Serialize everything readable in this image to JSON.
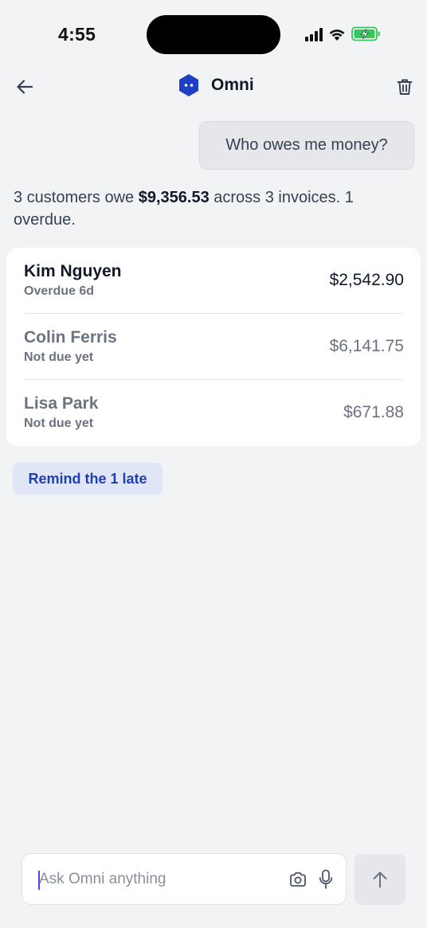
{
  "status_bar": {
    "time": "4:55",
    "icons": [
      "signal-icon",
      "wifi-icon",
      "battery-charging-icon"
    ],
    "battery_color": "#34c759"
  },
  "header": {
    "title": "Omni",
    "back_icon": "arrow-left-icon",
    "logo_icon": "hexagon-logo-icon",
    "delete_icon": "trash-icon",
    "brand_color": "#1f3fc4"
  },
  "conversation": {
    "user_message": "Who owes me money?",
    "summary": {
      "prefix": "3 customers owe ",
      "amount": "$9,356.53",
      "suffix": " across 3 invoices. 1 overdue."
    },
    "customers": [
      {
        "name": "Kim Nguyen",
        "status": "Overdue 6d",
        "amount": "$2,542.90"
      },
      {
        "name": "Colin Ferris",
        "status": "Not due yet",
        "amount": "$6,141.75"
      },
      {
        "name": "Lisa Park",
        "status": "Not due yet",
        "amount": "$671.88"
      }
    ],
    "action_chip": "Remind the 1 late"
  },
  "composer": {
    "placeholder": "Ask Omni anything",
    "value": "",
    "camera_icon": "camera-icon",
    "mic_icon": "microphone-icon",
    "send_icon": "arrow-up-icon"
  }
}
